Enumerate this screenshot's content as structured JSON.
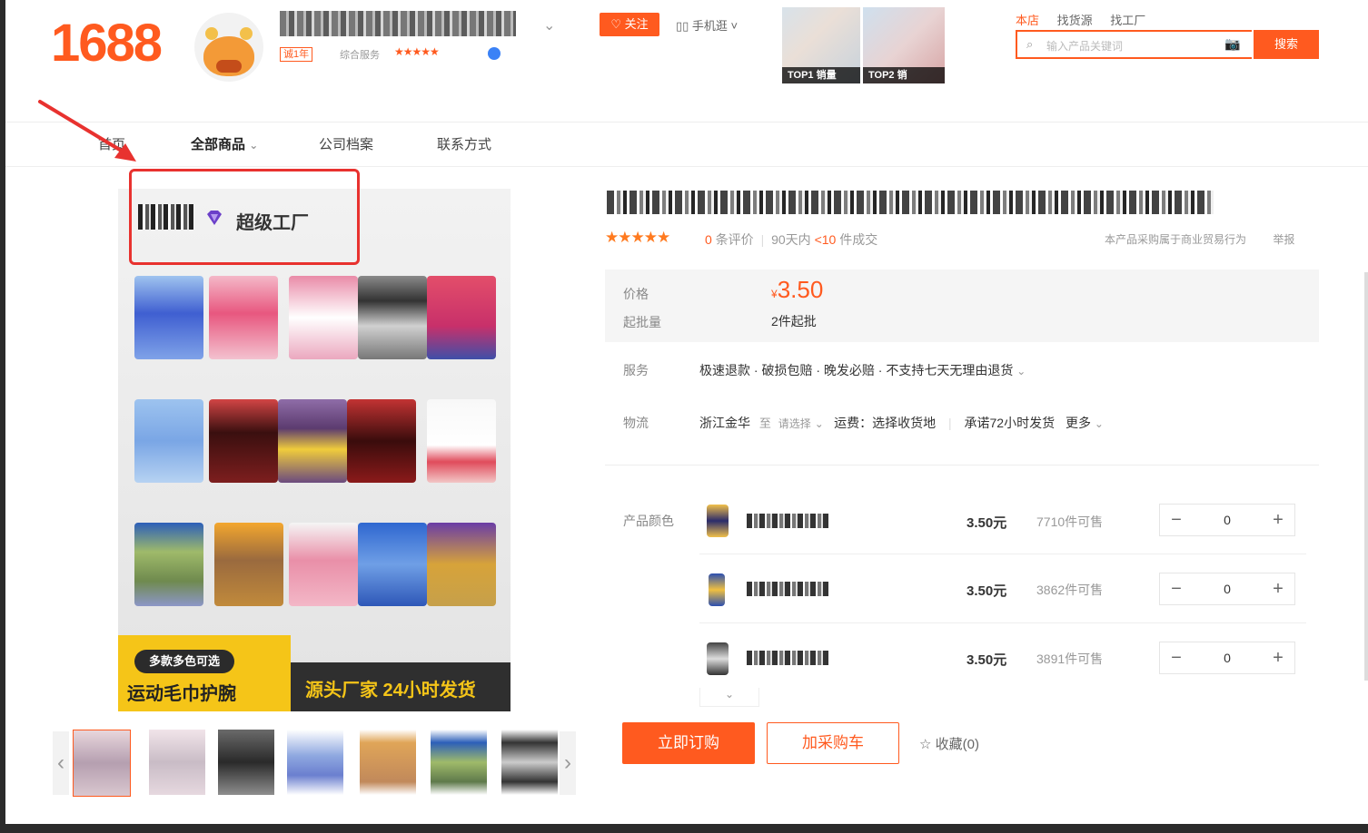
{
  "header": {
    "logo": "1688",
    "shop_name_obscured": "",
    "year_tag": "诚1年",
    "service_label": "综合服务",
    "service_stars": "★★★★★",
    "follow_label": "♡ 关注",
    "mobile_label": "▯▯ 手机逛 ˅",
    "top1_label": "TOP1 销量",
    "top2_label": "TOP2 销",
    "links": [
      "本店",
      "找货源",
      "找工厂"
    ],
    "search_placeholder": "输入产品关键词",
    "search_button": "搜索"
  },
  "nav": {
    "items": [
      "首页",
      "全部商品",
      "公司档案",
      "联系方式"
    ],
    "active_index": 1
  },
  "badge": {
    "text": "超级工厂",
    "color": "#e8322f"
  },
  "banner": {
    "pill": "多款多色可选",
    "title": "运动毛巾护腕",
    "slogan": "源头厂家 24小时发货"
  },
  "product": {
    "rating_stars": "★★★★★",
    "reviews_count": "0",
    "reviews_suffix": "条评价",
    "sep": "|",
    "deals_prefix": "90天内",
    "deals_value": "<10",
    "deals_suffix": "件成交",
    "report_note": "本产品采购属于商业贸易行为",
    "report_link": "举报",
    "price_label": "价格",
    "currency": "¥",
    "price": "3.50",
    "min_label": "起批量",
    "min_value": "2件起批",
    "service_label": "服务",
    "service_value": "极速退款 · 破损包赔 · 晚发必赔 · 不支持七天无理由退货",
    "logistics_label": "物流",
    "origin": "浙江金华",
    "to": "至",
    "select_dest": "请选择",
    "shipping_fee": "运费：选择收货地",
    "promise": "承诺72小时发货",
    "more": "更多",
    "color_label": "产品颜色",
    "skus": [
      {
        "price": "3.50元",
        "stock": "7710件可售",
        "qty": "0"
      },
      {
        "price": "3.50元",
        "stock": "3862件可售",
        "qty": "0"
      },
      {
        "price": "3.50元",
        "stock": "3891件可售",
        "qty": "0"
      }
    ],
    "buy_now": "立即订购",
    "add_cart": "加采购车",
    "favorite": "收藏(0)"
  },
  "colors": {
    "accent": "#ff5a1f",
    "highlight": "#e8322f"
  }
}
